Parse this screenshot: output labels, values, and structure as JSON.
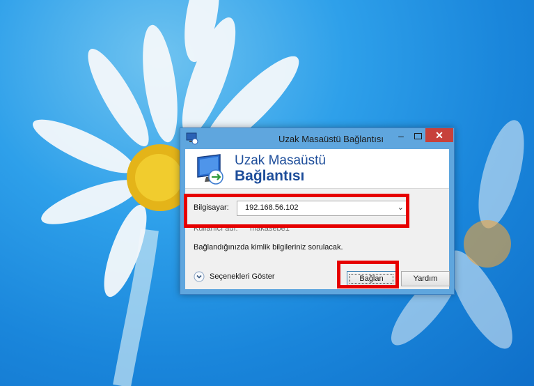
{
  "window": {
    "title": "Uzak Masaüstü Bağlantısı",
    "minimize_glyph": "–",
    "close_glyph": "✕"
  },
  "banner": {
    "line1": "Uzak Masaüstü",
    "line2": "Bağlantısı"
  },
  "form": {
    "computer_label": "Bilgisayar:",
    "computer_value": "192.168.56.102",
    "user_label": "Kullanıcı adı:",
    "user_value": "makasebe1",
    "note": "Bağlandığınızda kimlik bilgileriniz sorulacak."
  },
  "footer": {
    "options_label": "Seçenekleri Göster",
    "connect_label": "Bağlan",
    "help_label": "Yardım"
  },
  "icons": {
    "app": "rdp-app-icon",
    "logo": "rdp-monitor-icon",
    "options": "chevron-down-circle-icon",
    "dropdown": "chevron-down-icon"
  },
  "colors": {
    "highlight": "#e60000",
    "close_button": "#c7413b",
    "banner_text": "#1d4d9a"
  }
}
